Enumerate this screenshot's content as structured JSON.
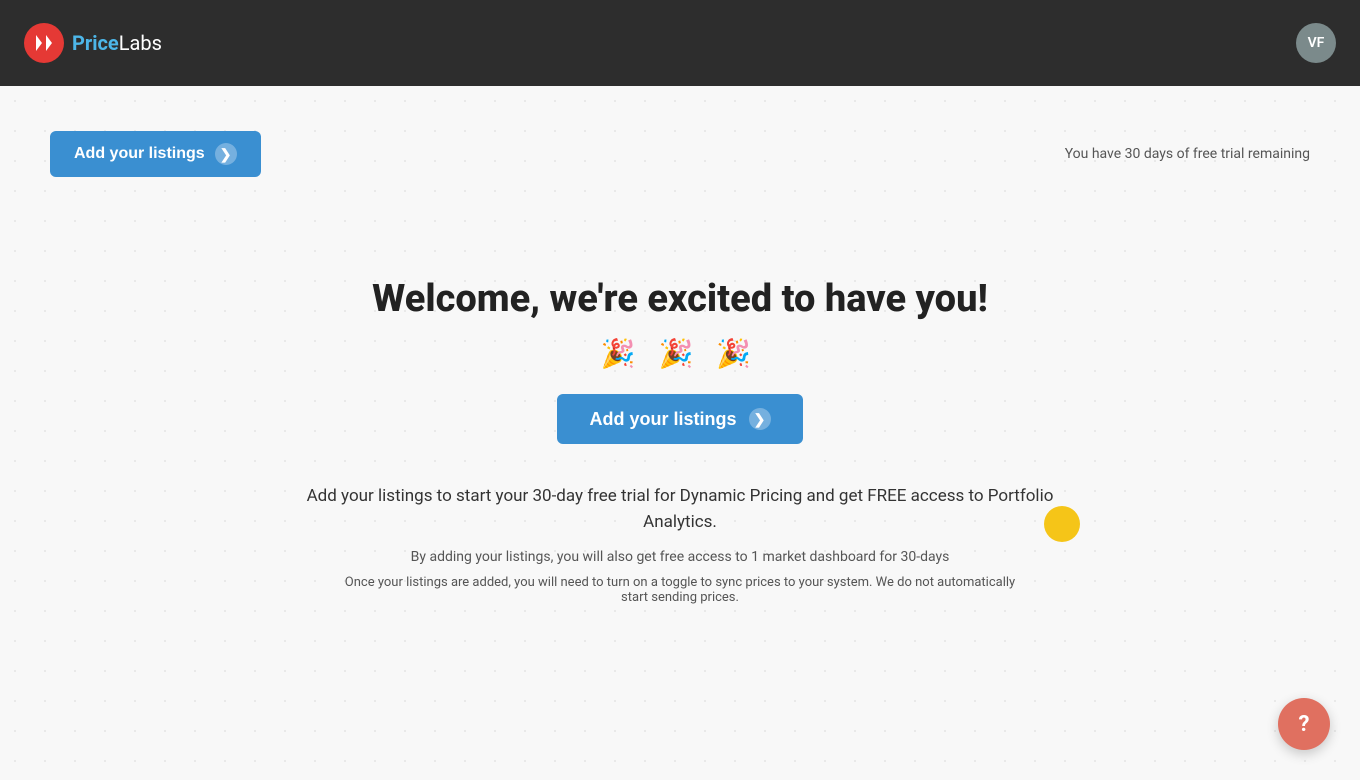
{
  "header": {
    "logo_icon_text": "◁▷",
    "logo_price": "Price",
    "logo_labs": "Labs",
    "user_initials": "VF"
  },
  "top_bar": {
    "add_listings_btn": "Add your listings",
    "trial_text": "You have 30 days of free trial remaining"
  },
  "welcome": {
    "title": "Welcome, we're excited to have you!",
    "emojis": "🎉 🎉 🎉",
    "add_listings_btn": "Add your listings",
    "description_main": "Add your listings to start your 30-day free trial for Dynamic Pricing and get FREE access to Portfolio Analytics.",
    "description_sub": "By adding your listings, you will also get free access to 1 market dashboard for 30-days",
    "description_note": "Once your listings are added, you will need to turn on a toggle to sync prices to your system. We do not automatically start sending prices."
  },
  "help_button": {
    "label": "?"
  },
  "colors": {
    "header_bg": "#2d2d2d",
    "btn_bg": "#3a8fd1",
    "logo_icon_bg": "#e53935",
    "yellow_circle": "#f5c518",
    "help_btn_bg": "#e07060"
  }
}
